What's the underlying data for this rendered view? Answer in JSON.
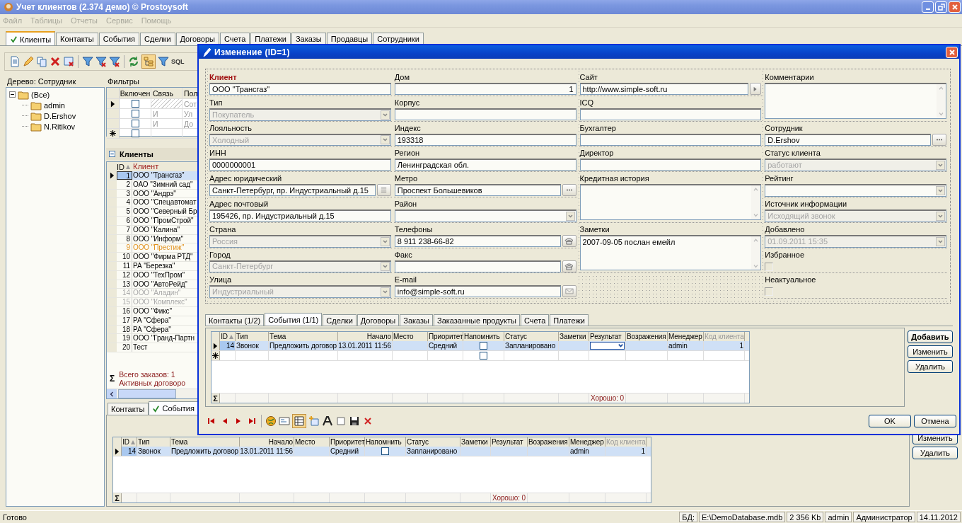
{
  "window": {
    "title": "Учет клиентов (2.374 демо) © Prostoysoft"
  },
  "menu": [
    "Файл",
    "Таблицы",
    "Отчеты",
    "Сервис",
    "Помощь"
  ],
  "tabs": [
    {
      "label": "Клиенты",
      "selected": true
    },
    {
      "label": "Контакты",
      "selected": false
    },
    {
      "label": "События",
      "selected": false
    },
    {
      "label": "Сделки",
      "selected": false
    },
    {
      "label": "Договоры",
      "selected": false
    },
    {
      "label": "Счета",
      "selected": false
    },
    {
      "label": "Платежи",
      "selected": false
    },
    {
      "label": "Заказы",
      "selected": false
    },
    {
      "label": "Продавцы",
      "selected": false
    },
    {
      "label": "Сотрудники",
      "selected": false
    }
  ],
  "toolbar": {
    "sql_label": "SQL"
  },
  "tree": {
    "title": "Дерево: Сотрудник",
    "items": [
      {
        "label": "(Все)",
        "expanded": true,
        "children": [
          {
            "label": "admin"
          },
          {
            "label": "D.Ershov"
          },
          {
            "label": "N.Ritikov"
          }
        ]
      }
    ]
  },
  "filters": {
    "title": "Фильтры",
    "columns": [
      "Включен",
      "Связь",
      "Пол"
    ],
    "rows": [
      {
        "enabled": false,
        "field": "Сот",
        "current": true
      },
      {
        "enabled": false,
        "link": "И",
        "field": "Ул",
        "current": false
      },
      {
        "enabled": false,
        "link": "И",
        "field": "До",
        "current": false
      }
    ],
    "new_row": {
      "enabled": false
    }
  },
  "clients": {
    "title": "Клиенты",
    "columns": [
      "ID",
      "Клиент"
    ],
    "rows": [
      {
        "id": "1",
        "name": "ООО \"Трансгаз\"",
        "selected": true
      },
      {
        "id": "2",
        "name": "ОАО \"Зимний сад\"",
        "selected": false
      },
      {
        "id": "3",
        "name": "ООО \"Андрэ\"",
        "selected": false
      },
      {
        "id": "4",
        "name": "ООО \"Спецавтомат",
        "selected": false
      },
      {
        "id": "5",
        "name": "ООО \"Северный Бр",
        "selected": false
      },
      {
        "id": "6",
        "name": "ООО \"ПромСтрой\"",
        "selected": false
      },
      {
        "id": "7",
        "name": "ООО \"Калина\"",
        "selected": false
      },
      {
        "id": "8",
        "name": "ООО \"Информ\"",
        "selected": false
      },
      {
        "id": "9",
        "name": "ООО \"Престиж\"",
        "selected": false,
        "color": "#e0901c"
      },
      {
        "id": "10",
        "name": "ООО \"Фирма РТД\"",
        "selected": false
      },
      {
        "id": "11",
        "name": "РА \"Березка\"",
        "selected": false
      },
      {
        "id": "12",
        "name": "ООО \"ТехПром\"",
        "selected": false
      },
      {
        "id": "13",
        "name": "ООО \"АвтоРейд\"",
        "selected": false
      },
      {
        "id": "14",
        "name": "ООО \"Аладин\"",
        "selected": false,
        "color": "#a8a8a8"
      },
      {
        "id": "15",
        "name": "ООО \"Комплекс\"",
        "selected": false,
        "color": "#a8a8a8"
      },
      {
        "id": "16",
        "name": "ООО \"Фикс\"",
        "selected": false
      },
      {
        "id": "17",
        "name": "РА \"Сфера\"",
        "selected": false
      },
      {
        "id": "18",
        "name": "РА \"Сфера\"",
        "selected": false
      },
      {
        "id": "19",
        "name": "ООО \"Гранд-Партн",
        "selected": false
      },
      {
        "id": "20",
        "name": "Тест",
        "selected": false
      }
    ],
    "sum_label": "Σ",
    "footer": [
      "Всего заказов: 1",
      "Активных договоро"
    ]
  },
  "lower": {
    "tabs": [
      {
        "label": "Контакты",
        "selected": false
      },
      {
        "label": "События",
        "selected": true
      }
    ],
    "events": {
      "columns": [
        {
          "label": "ID",
          "kind": "number",
          "sorted": true
        },
        {
          "label": "Тип",
          "kind": "text"
        },
        {
          "label": "Тема",
          "kind": "text"
        },
        {
          "label": "Начало",
          "kind": "number"
        },
        {
          "label": "Место",
          "kind": "text"
        },
        {
          "label": "Приоритет",
          "kind": "text"
        },
        {
          "label": "Напомнить",
          "kind": "check"
        },
        {
          "label": "Статус",
          "kind": "text"
        },
        {
          "label": "Заметки",
          "kind": "text"
        },
        {
          "label": "Результат",
          "kind": "combo",
          "footer": "Хорошо: 0"
        },
        {
          "label": "Возражения",
          "kind": "text"
        },
        {
          "label": "Менеджер",
          "kind": "text"
        },
        {
          "label": "Код клиента",
          "kind": "dim"
        }
      ],
      "rows": [
        {
          "cells": [
            "14",
            "Звонок",
            "Предложить договор",
            "13.01.2011 11:56",
            null,
            "Средний",
            null,
            "Запланировано",
            null,
            null,
            null,
            "admin",
            "1"
          ],
          "reminder": false,
          "current": true,
          "editing": false
        }
      ],
      "sum_label": "Σ"
    },
    "actions": [
      {
        "label": "Изменить",
        "default": false
      },
      {
        "label": "Удалить",
        "default": false
      }
    ]
  },
  "dialog": {
    "title": "Изменение (ID=1)",
    "form": {
      "columns": [
        {
          "fields": [
            {
              "label": "Клиент",
              "kind": "text",
              "value": "ООО \"Трансгаз\"",
              "required": true,
              "disabled": false
            },
            {
              "label": "Тип",
              "kind": "combo",
              "value": "Покупатель",
              "required": false,
              "disabled": true
            },
            {
              "label": "Лояльность",
              "kind": "combo",
              "value": "Холодный",
              "required": false,
              "disabled": true
            },
            {
              "label": "ИНН",
              "kind": "text",
              "value": "0000000001",
              "required": false,
              "disabled": false
            },
            {
              "label": "Адрес юридический",
              "kind": "text-list",
              "value": "Санкт-Петербург, пр. Индустриальный д.15",
              "required": false,
              "disabled": false
            },
            {
              "label": "Адрес почтовый",
              "kind": "text",
              "value": "195426, пр. Индустриальный д.15",
              "required": false,
              "disabled": false
            },
            {
              "label": "Страна",
              "kind": "combo",
              "value": "Россия",
              "required": false,
              "disabled": true
            },
            {
              "label": "Город",
              "kind": "combo",
              "value": "Санкт-Петербург",
              "required": false,
              "disabled": true
            },
            {
              "label": "Улица",
              "kind": "combo",
              "value": "Индустриальный",
              "required": false,
              "disabled": true
            }
          ]
        },
        {
          "fields": [
            {
              "label": "Дом",
              "kind": "number",
              "value": "1",
              "required": false,
              "disabled": false
            },
            {
              "label": "Корпус",
              "kind": "text",
              "required": false,
              "disabled": false
            },
            {
              "label": "Индекс",
              "kind": "text",
              "value": "193318",
              "required": false,
              "disabled": false
            },
            {
              "label": "Регион",
              "kind": "text",
              "value": "Ленинградская обл.",
              "required": false,
              "disabled": false
            },
            {
              "label": "Метро",
              "kind": "text-dots",
              "value": "Проспект Большевиков",
              "required": false,
              "disabled": false
            },
            {
              "label": "Район",
              "kind": "combo",
              "required": false,
              "disabled": false
            },
            {
              "label": "Телефоны",
              "kind": "text-phone",
              "value": "8 911 238-66-82",
              "required": false,
              "disabled": false
            },
            {
              "label": "Факс",
              "kind": "text-phone",
              "required": false,
              "disabled": false
            },
            {
              "label": "E-mail",
              "kind": "text-mail",
              "value": "info@simple-soft.ru",
              "required": false,
              "disabled": false
            }
          ]
        },
        {
          "fields": [
            {
              "label": "Сайт",
              "kind": "text-link",
              "value": "http://www.simple-soft.ru",
              "required": false,
              "disabled": false
            },
            {
              "label": "ICQ",
              "kind": "text",
              "required": false,
              "disabled": false
            },
            {
              "label": "Бухгалтер",
              "kind": "text",
              "required": false,
              "disabled": false
            },
            {
              "label": "Директор",
              "kind": "text",
              "required": false,
              "disabled": false
            },
            {
              "label": "Кредитная история",
              "kind": "memo",
              "required": false,
              "disabled": false
            },
            {
              "label": "Заметки",
              "kind": "memo",
              "value": "2007-09-05 послан емейл",
              "required": false,
              "disabled": false
            }
          ]
        },
        {
          "fields": [
            {
              "label": "Комментарии",
              "kind": "memo",
              "required": false,
              "disabled": false
            },
            {
              "label": "Сотрудник",
              "kind": "text-dots",
              "value": "D.Ershov",
              "required": false,
              "disabled": false
            },
            {
              "label": "Статус клиента",
              "kind": "combo",
              "value": "работают",
              "required": false,
              "disabled": true
            },
            {
              "label": "Рейтинг",
              "kind": "combo",
              "required": false,
              "disabled": false
            },
            {
              "label": "Источник информации",
              "kind": "combo",
              "value": "Исходящий звонок",
              "required": false,
              "disabled": true
            },
            {
              "label": "Добавлено",
              "kind": "combo",
              "value": "01.09.2011 15:35",
              "required": false,
              "disabled": true
            },
            {
              "label": "Избранное",
              "kind": "check",
              "checked": false,
              "required": false,
              "disabled": false
            },
            {
              "label": "Неактуальное",
              "kind": "check",
              "checked": false,
              "required": false,
              "disabled": false
            }
          ]
        }
      ]
    },
    "subtabs": [
      {
        "label": "Контакты (1/2)",
        "selected": false
      },
      {
        "label": "События (1/1)",
        "selected": true
      },
      {
        "label": "Сделки",
        "selected": false
      },
      {
        "label": "Договоры",
        "selected": false
      },
      {
        "label": "Заказы",
        "selected": false
      },
      {
        "label": "Заказанные продукты",
        "selected": false
      },
      {
        "label": "Счета",
        "selected": false
      },
      {
        "label": "Платежи",
        "selected": false
      }
    ],
    "events": {
      "columns": [
        {
          "label": "ID",
          "kind": "number",
          "sorted": true
        },
        {
          "label": "Тип",
          "kind": "text"
        },
        {
          "label": "Тема",
          "kind": "text"
        },
        {
          "label": "Начало",
          "kind": "number"
        },
        {
          "label": "Место",
          "kind": "text"
        },
        {
          "label": "Приоритет",
          "kind": "text"
        },
        {
          "label": "Напомнить",
          "kind": "check"
        },
        {
          "label": "Статус",
          "kind": "text"
        },
        {
          "label": "Заметки",
          "kind": "text"
        },
        {
          "label": "Результат",
          "kind": "combo",
          "footer": "Хорошо: 0"
        },
        {
          "label": "Возражения",
          "kind": "text"
        },
        {
          "label": "Менеджер",
          "kind": "text"
        },
        {
          "label": "Код клиента",
          "kind": "dim"
        }
      ],
      "rows": [
        {
          "cells": [
            "14",
            "Звонок",
            "Предложить договор",
            "13.01.2011 11:56",
            null,
            "Средний",
            null,
            "Запланировано",
            null,
            null,
            null,
            "admin",
            "1"
          ],
          "reminder": false,
          "current": true,
          "editing": true
        }
      ],
      "new_row": {
        "reminder": false
      },
      "sum_label": "Σ"
    },
    "actions": [
      {
        "label": "Добавить",
        "default": true
      },
      {
        "label": "Изменить",
        "default": false
      },
      {
        "label": "Удалить",
        "default": false
      }
    ],
    "buttons": [
      "OK",
      "Отмена"
    ]
  },
  "status_bar": {
    "text": "Готово",
    "panels": [
      "БД:",
      "E:\\DemoDatabase.mdb",
      "2 356 Kb",
      "admin",
      "Администратор",
      "14.11.2012"
    ]
  }
}
